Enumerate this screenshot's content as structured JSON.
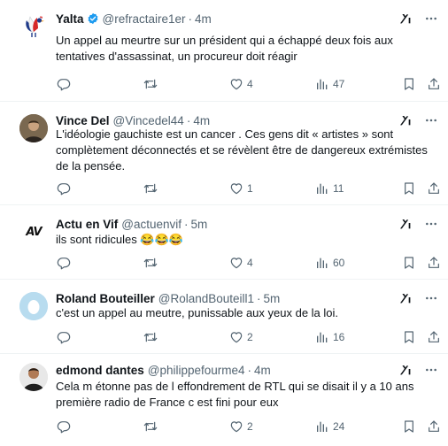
{
  "tweets": [
    {
      "name": "Yalta",
      "handle": "@refractaire1er",
      "sep": "·",
      "time": "4m",
      "text": "Un appel au meurtre sur un président qui a échappé deux fois aux tentatives d'assassinat, un procureur doit réagir",
      "replies": "",
      "retweets": "",
      "likes": "4",
      "views": "47",
      "verified": true
    },
    {
      "name": "Vince Del",
      "handle": "@Vincedel44",
      "sep": "·",
      "time": "4m",
      "text": "L'idéologie gauchiste est un cancer . Ces gens dit « artistes » sont complètement déconnectés et se révèlent être de dangereux extrémistes de la pensée.",
      "replies": "",
      "retweets": "",
      "likes": "1",
      "views": "11"
    },
    {
      "name": "Actu en Vif",
      "handle": "@actuenvif",
      "sep": "·",
      "time": "5m",
      "avatar_text": "AV",
      "text": "ils sont ridicules 😂😂😂",
      "replies": "",
      "retweets": "",
      "likes": "4",
      "views": "60"
    },
    {
      "name": "Roland Bouteiller",
      "handle": "@RolandBouteill1",
      "sep": "·",
      "time": "5m",
      "text": "c'est un appel au meutre, punissable aux yeux de la loi.",
      "replies": "",
      "retweets": "",
      "likes": "2",
      "views": "16"
    },
    {
      "name": "edmond dantes",
      "handle": "@philippefourme4",
      "sep": "·",
      "time": "4m",
      "text": "Cela m étonne  pas de l effondrement  de RTL qui se disait il y a 10 ans première  radio  de France  c est fini  pour eux",
      "replies": "",
      "retweets": "",
      "likes": "2",
      "views": "24"
    }
  ],
  "colors": {
    "text": "#0f1419",
    "secondary": "#536471",
    "verified": "#1d9bf0",
    "divider": "#eff3f4"
  },
  "icons": [
    "grok-icon",
    "more-icon",
    "reply-icon",
    "retweet-icon",
    "like-icon",
    "views-icon",
    "bookmark-icon",
    "share-icon",
    "verified-badge-icon"
  ]
}
